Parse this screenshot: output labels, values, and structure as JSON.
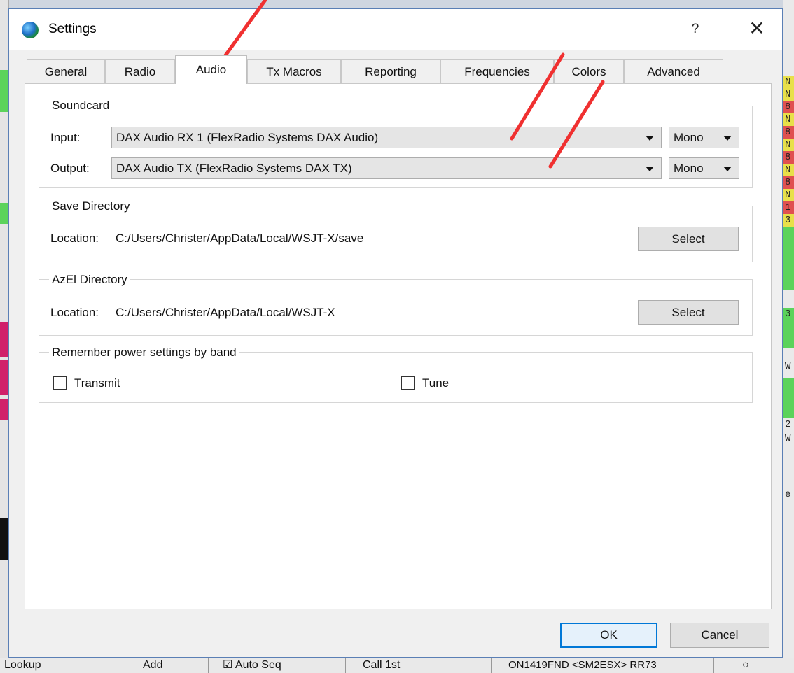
{
  "window": {
    "title": "Settings",
    "help_label": "?",
    "close_label": "✕"
  },
  "tabs": [
    {
      "label": "General"
    },
    {
      "label": "Radio"
    },
    {
      "label": "Audio",
      "active": true
    },
    {
      "label": "Tx Macros"
    },
    {
      "label": "Reporting"
    },
    {
      "label": "Frequencies"
    },
    {
      "label": "Colors"
    },
    {
      "label": "Advanced"
    }
  ],
  "soundcard": {
    "title": "Soundcard",
    "input_label": "Input:",
    "input_device": "DAX Audio RX 1 (FlexRadio Systems DAX Audio)",
    "input_channel": "Mono",
    "output_label": "Output:",
    "output_device": "DAX Audio TX (FlexRadio Systems DAX TX)",
    "output_channel": "Mono"
  },
  "save_directory": {
    "title": "Save Directory",
    "location_label": "Location:",
    "path": "C:/Users/Christer/AppData/Local/WSJT-X/save",
    "select_label": "Select"
  },
  "azel_directory": {
    "title": "AzEl Directory",
    "location_label": "Location:",
    "path": "C:/Users/Christer/AppData/Local/WSJT-X",
    "select_label": "Select"
  },
  "power": {
    "title": "Remember power settings by band",
    "transmit_label": "Transmit",
    "transmit_checked": false,
    "tune_label": "Tune",
    "tune_checked": false
  },
  "footer": {
    "ok_label": "OK",
    "cancel_label": "Cancel"
  },
  "background_app": {
    "bottom_bar": [
      "Lookup",
      "Add",
      "Auto Seq",
      "Call 1st",
      "ON1419FND <SM2ESX> RR73"
    ],
    "auto_seq_checked": true,
    "right_strip": [
      "N",
      "N",
      "8",
      "N",
      "8",
      "N",
      "8",
      "N",
      "8",
      "N",
      "1",
      "3",
      "",
      "3",
      "",
      "",
      "W",
      "",
      "",
      "2",
      "W",
      "",
      "",
      "e"
    ]
  },
  "colors": {
    "annotation": "#f03030",
    "accent": "#0078d7",
    "decode_yellow": "#e8e04a",
    "decode_green": "#5bd35b",
    "decode_red": "#e05050",
    "decode_pink": "#d0206a"
  }
}
